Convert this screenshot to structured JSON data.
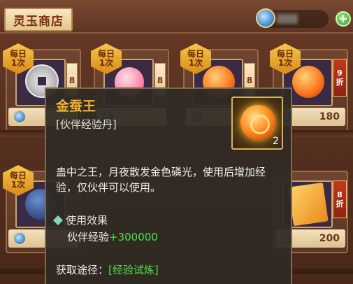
{
  "shop": {
    "title": "灵玉商店",
    "add_icon": "plus-icon",
    "currency_icon": "jade-coin-icon"
  },
  "daily_badge": {
    "line1": "每日",
    "line2": "1次"
  },
  "cards": [
    {
      "item": "silver-coin",
      "limit": "8",
      "price": ""
    },
    {
      "item": "peach",
      "limit": "8",
      "price": ""
    },
    {
      "item": "orange-orb",
      "limit": "8",
      "price": ""
    },
    {
      "item": "golden-silkworm",
      "discount": [
        "9",
        "折"
      ],
      "count": "2",
      "price": "180"
    },
    {
      "item": "dark-item",
      "price": ""
    },
    {
      "item": "golden-scroll",
      "discount": [
        "8",
        "折"
      ],
      "price": "200"
    }
  ],
  "tooltip": {
    "name": "金蚕王",
    "type": "[伙伴经验丹]",
    "count": "2",
    "description": "蛊中之王，月夜散发金色磷光，使用后增加经验，仅伙伴可以使用。",
    "effect_title": "使用效果",
    "effect_label": "伙伴经验",
    "effect_value": "+300000",
    "source_label": "获取途径：",
    "source_value": "[经验试炼]"
  },
  "colors": {
    "item_name": "#f3b32c",
    "effect_value": "#4ce04c",
    "shop_title": "#7a2d10"
  }
}
